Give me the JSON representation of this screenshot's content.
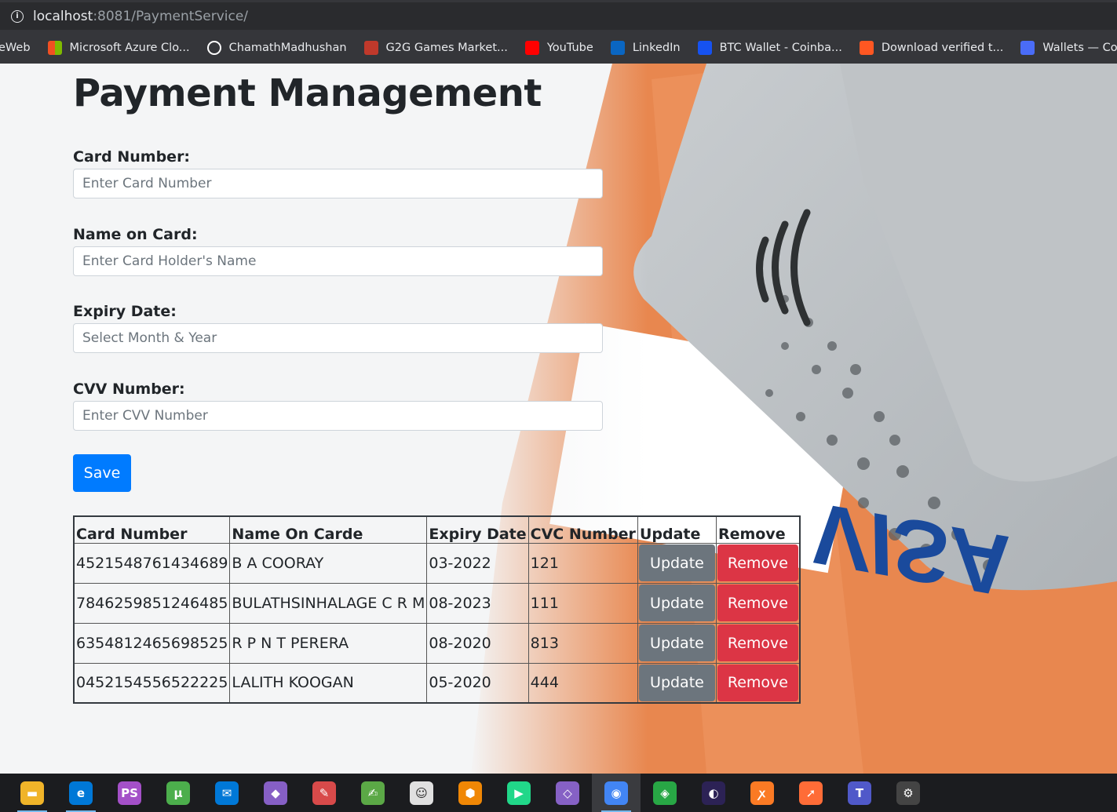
{
  "browser": {
    "url_host": "localhost",
    "url_rest": ":8081/PaymentService/",
    "bookmarks": [
      {
        "label": "eWeb",
        "icon": "none",
        "color": ""
      },
      {
        "label": "Microsoft Azure Clo...",
        "icon": "microsoft-icon",
        "color": "#f25022"
      },
      {
        "label": "ChamathMadhushan",
        "icon": "github-icon",
        "color": "#ffffff"
      },
      {
        "label": "G2G Games Market...",
        "icon": "g2g-icon",
        "color": "#c0392b"
      },
      {
        "label": "YouTube",
        "icon": "youtube-icon",
        "color": "#ff0000"
      },
      {
        "label": "LinkedIn",
        "icon": "linkedin-icon",
        "color": "#0a66c2"
      },
      {
        "label": "BTC Wallet - Coinba...",
        "icon": "coinbase-icon",
        "color": "#1652f0"
      },
      {
        "label": "Download verified t...",
        "icon": "x-icon",
        "color": "#ff5722"
      },
      {
        "label": "Wallets — CoinsBank",
        "icon": "coinsbank-icon",
        "color": "#4a6cf7"
      }
    ]
  },
  "page": {
    "title": "Payment Management",
    "form": {
      "card_number_label": "Card Number:",
      "card_number_placeholder": "Enter Card Number",
      "name_label": "Name on Card:",
      "name_placeholder": "Enter Card Holder's Name",
      "expiry_label": "Expiry Date:",
      "expiry_placeholder": "Select Month & Year",
      "cvv_label": "CVV Number:",
      "cvv_placeholder": "Enter CVV Number",
      "save_label": "Save"
    },
    "table": {
      "headers": [
        "Card Number",
        "Name On Carde",
        "Expiry Date",
        "CVC Number",
        "Update",
        "Remove"
      ],
      "update_label": "Update",
      "remove_label": "Remove",
      "rows": [
        {
          "card": "4521548761434689",
          "name": "B A COORAY",
          "expiry": "03-2022",
          "cvc": "121"
        },
        {
          "card": "7846259851246485",
          "name": "BULATHSINHALAGE C R M",
          "expiry": "08-2023",
          "cvc": "111"
        },
        {
          "card": "6354812465698525",
          "name": "R P N T PERERA",
          "expiry": "08-2020",
          "cvc": "813"
        },
        {
          "card": "0452154556522225",
          "name": "LALITH KOOGAN",
          "expiry": "05-2020",
          "cvc": "444"
        }
      ]
    }
  },
  "colors": {
    "primary": "#007bff",
    "secondary": "#6c757d",
    "danger": "#dc3545"
  },
  "taskbar": [
    {
      "icon": "file-explorer-icon",
      "color": "#f0b429",
      "glyph": "▬"
    },
    {
      "icon": "edge-icon",
      "color": "#0078d7",
      "glyph": "e"
    },
    {
      "icon": "phpstorm-icon",
      "color": "#a450c8",
      "glyph": "PS"
    },
    {
      "icon": "utorrent-icon",
      "color": "#4cae4c",
      "glyph": "µ"
    },
    {
      "icon": "mail-icon",
      "color": "#0078d7",
      "glyph": "✉"
    },
    {
      "icon": "visual-studio-icon",
      "color": "#865fc5",
      "glyph": "◆"
    },
    {
      "icon": "paint-icon",
      "color": "#d84a4a",
      "glyph": "✎"
    },
    {
      "icon": "notepad-icon",
      "color": "#5ba846",
      "glyph": "✍"
    },
    {
      "icon": "emoji-icon",
      "color": "#e0e0e0",
      "glyph": "☺"
    },
    {
      "icon": "draw-icon",
      "color": "#f08705",
      "glyph": "⬢"
    },
    {
      "icon": "pycharm-icon",
      "color": "#21d789",
      "glyph": "▶"
    },
    {
      "icon": "vscode-icon",
      "color": "#8661c5",
      "glyph": "◇"
    },
    {
      "icon": "chrome-icon",
      "color": "#4285f4",
      "glyph": "◉",
      "active": true
    },
    {
      "icon": "git-icon",
      "color": "#28a745",
      "glyph": "◈"
    },
    {
      "icon": "eclipse-icon",
      "color": "#2c2255",
      "glyph": "◐"
    },
    {
      "icon": "xampp-icon",
      "color": "#fb7a24",
      "glyph": "ꭗ"
    },
    {
      "icon": "postman-icon",
      "color": "#ff6c37",
      "glyph": "➚"
    },
    {
      "icon": "teams-icon",
      "color": "#5059c9",
      "glyph": "T"
    },
    {
      "icon": "settings-icon",
      "color": "#444",
      "glyph": "⚙"
    }
  ]
}
